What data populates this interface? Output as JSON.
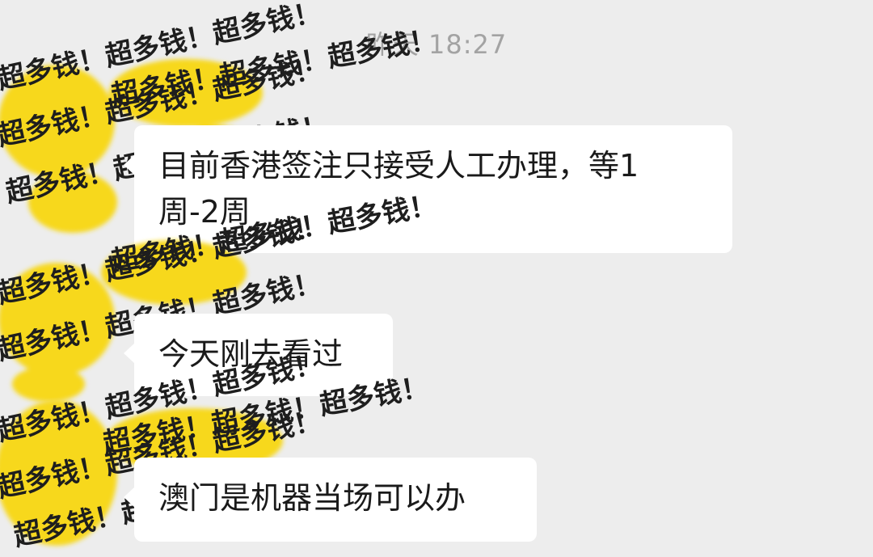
{
  "chat": {
    "timestamp": "昨天 18:27",
    "sticker_pattern": "超多钱！超多钱！超多钱！",
    "messages": [
      {
        "text_line1": "目前香港签注只接受人工办理，等1",
        "text_line2": "周-2周"
      },
      {
        "text_line1": "今天刚去看过"
      },
      {
        "text_line1": "澳门是机器当场可以办"
      }
    ]
  },
  "colors": {
    "background": "#ededed",
    "bubble": "#ffffff",
    "sticker_yellow": "#f7d81c",
    "timestamp": "#a3a3a3"
  }
}
